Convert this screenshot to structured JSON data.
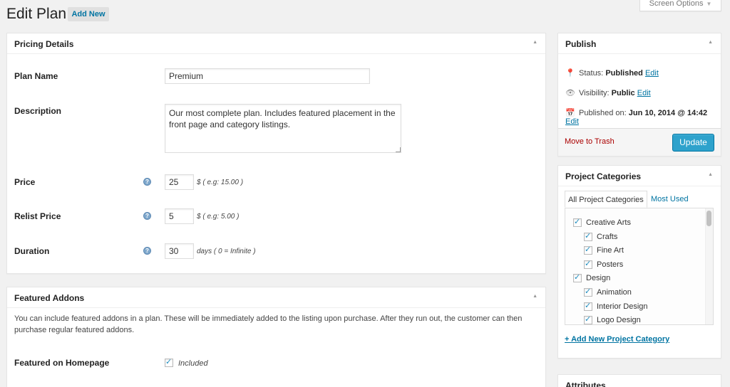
{
  "header": {
    "title": "Edit Plan",
    "add_new_label": "Add New",
    "screen_options_label": "Screen Options"
  },
  "pricing": {
    "title": "Pricing Details",
    "plan_name_label": "Plan Name",
    "plan_name_value": "Premium",
    "description_label": "Description",
    "description_value": "Our most complete plan. Includes featured placement in the front page and category listings.",
    "price_label": "Price",
    "price_value": "25",
    "price_hint": "$ ( e.g: 15.00 )",
    "relist_label": "Relist Price",
    "relist_value": "5",
    "relist_hint": "$ ( e.g: 5.00 )",
    "duration_label": "Duration",
    "duration_value": "30",
    "duration_hint": "days ( 0 = Infinite )"
  },
  "addons": {
    "title": "Featured Addons",
    "description": "You can include featured addons in a plan. These will be immediately added to the listing upon purchase. After they run out, the customer can then purchase regular featured addons.",
    "homepage_label": "Featured on Homepage",
    "homepage_checked": true,
    "included_label": "Included"
  },
  "publish": {
    "title": "Publish",
    "status_label": "Status:",
    "status_value": "Published",
    "visibility_label": "Visibility:",
    "visibility_value": "Public",
    "published_label": "Published on:",
    "published_value": "Jun 10, 2014 @ 14:42",
    "edit_label": "Edit",
    "trash_label": "Move to Trash",
    "update_label": "Update"
  },
  "categories": {
    "title": "Project Categories",
    "tab_all": "All Project Categories",
    "tab_most_used": "Most Used",
    "items": [
      {
        "label": "Creative Arts",
        "checked": true,
        "level": 0
      },
      {
        "label": "Crafts",
        "checked": true,
        "level": 1
      },
      {
        "label": "Fine Art",
        "checked": true,
        "level": 1
      },
      {
        "label": "Posters",
        "checked": true,
        "level": 1
      },
      {
        "label": "Design",
        "checked": true,
        "level": 0
      },
      {
        "label": "Animation",
        "checked": true,
        "level": 1
      },
      {
        "label": "Interior Design",
        "checked": true,
        "level": 1
      },
      {
        "label": "Logo Design",
        "checked": true,
        "level": 1
      }
    ],
    "add_new_label": "+ Add New Project Category"
  },
  "attributes": {
    "title": "Attributes"
  },
  "colors": {
    "accent": "#0074a2",
    "primary_button": "#2ea2cc",
    "trash": "#a00000"
  }
}
